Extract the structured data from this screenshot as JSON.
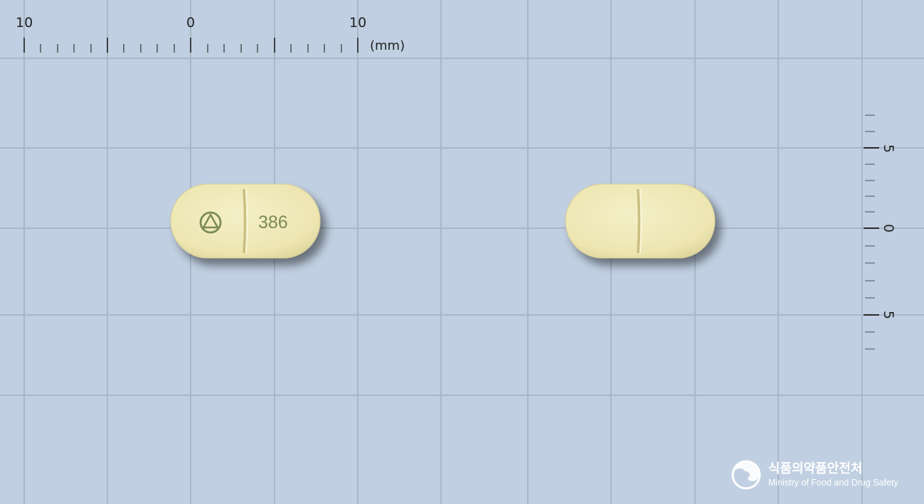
{
  "ruler_top": {
    "labels": [
      "10",
      "0",
      "10"
    ],
    "unit": "(mm)"
  },
  "ruler_side": {
    "labels": [
      "5",
      "0",
      "5"
    ]
  },
  "pills": {
    "front": {
      "logo": "triangle-in-circle-logo",
      "imprint": "386"
    },
    "back": {
      "score_line": true
    }
  },
  "watermark": {
    "korean": "식품의약품안전처",
    "english": "Ministry of Food and Drug Safety"
  },
  "colors": {
    "background": "#c0cfe1",
    "grid": "#a9b7c8",
    "pill": "#f2ecbf",
    "imprint": "#7a8b52"
  }
}
